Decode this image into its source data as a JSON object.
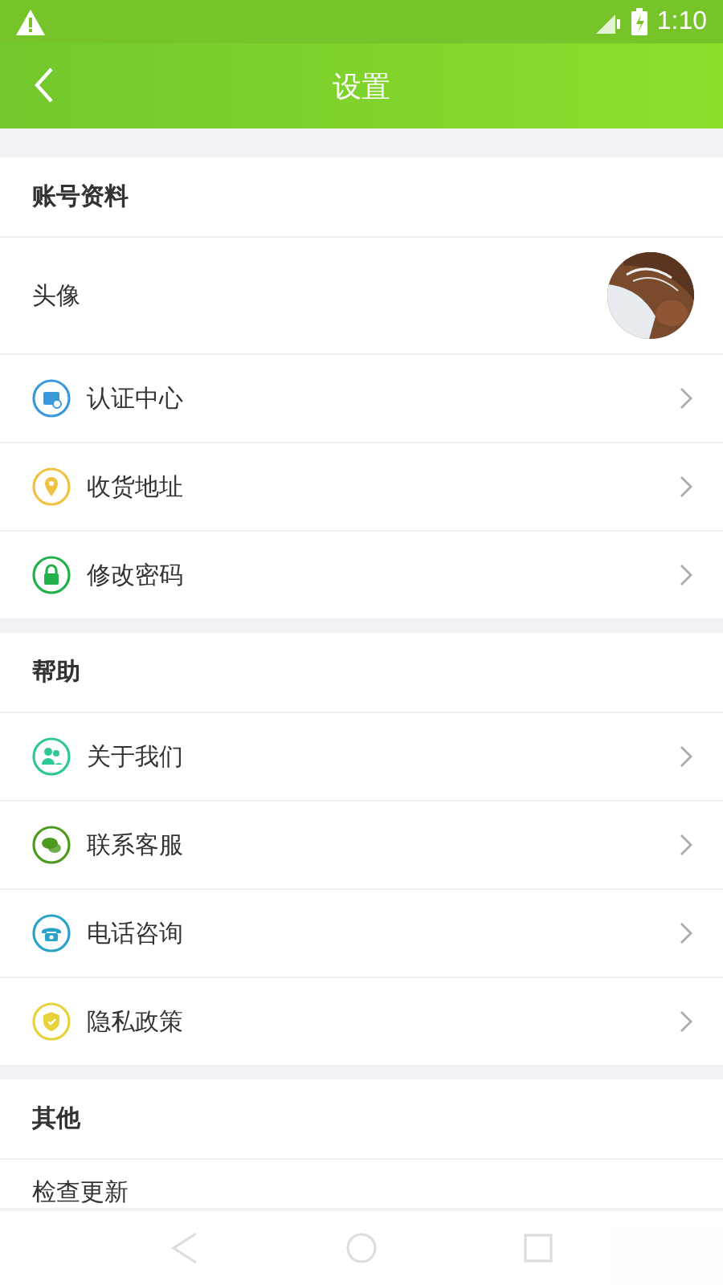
{
  "status_bar": {
    "time": "1:10"
  },
  "header": {
    "title": "设置"
  },
  "sections": [
    {
      "title": "账号资料",
      "items": [
        {
          "kind": "avatar",
          "label": "头像"
        },
        {
          "kind": "link",
          "color": "#3a9ad9",
          "label": "认证中心"
        },
        {
          "kind": "link",
          "color": "#f0c040",
          "label": "收货地址"
        },
        {
          "kind": "link",
          "color": "#22b04a",
          "label": "修改密码"
        }
      ]
    },
    {
      "title": "帮助",
      "items": [
        {
          "kind": "link",
          "color": "#2fc79a",
          "label": "关于我们"
        },
        {
          "kind": "link",
          "color": "#4e9a1e",
          "label": "联系客服"
        },
        {
          "kind": "link",
          "color": "#2aa3c9",
          "label": "电话咨询"
        },
        {
          "kind": "link",
          "color": "#e8d23a",
          "label": "隐私政策"
        }
      ]
    },
    {
      "title": "其他",
      "items": [
        {
          "kind": "plain",
          "label": "检查更新"
        }
      ]
    }
  ]
}
